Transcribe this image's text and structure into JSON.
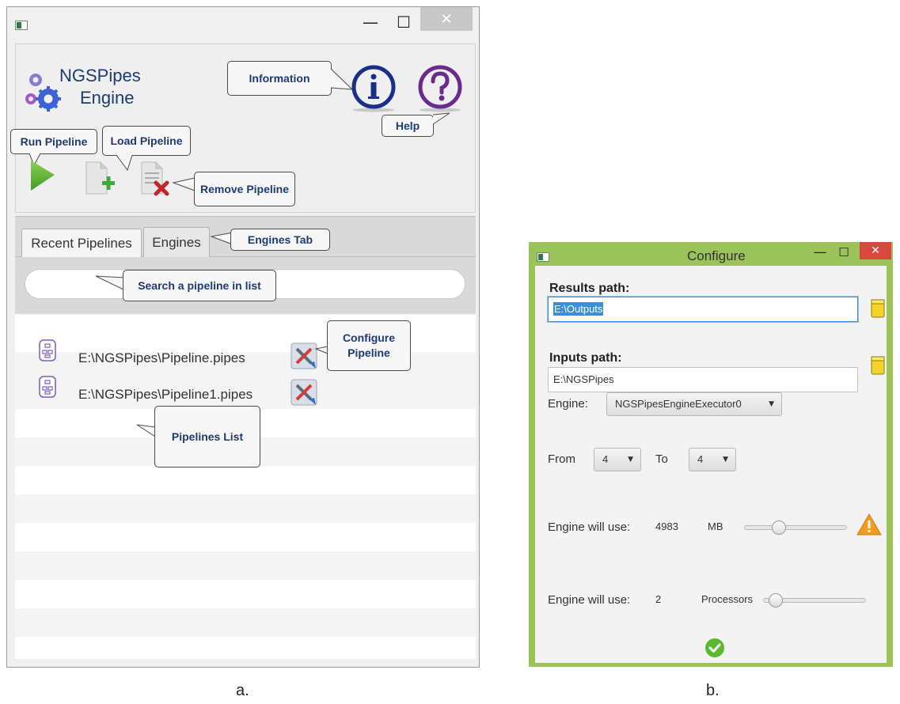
{
  "window_a": {
    "titlebar": {
      "minimize": "—",
      "maximize": "☐",
      "close": "✕"
    },
    "logo": {
      "line1": "NGSPipes",
      "line2": "Engine"
    },
    "callouts": {
      "information": "Information",
      "help": "Help",
      "run_pipeline": "Run Pipeline",
      "load_pipeline": "Load Pipeline",
      "remove_pipeline": "Remove Pipeline",
      "engines_tab": "Engines Tab",
      "search": "Search a pipeline in list",
      "configure_line1": "Configure",
      "configure_line2": "Pipeline",
      "pipelines_list": "Pipelines List"
    },
    "tabs": [
      {
        "label": "Recent Pipelines",
        "active": true
      },
      {
        "label": "Engines",
        "active": false
      }
    ],
    "search": {
      "placeholder": ""
    },
    "pipelines": [
      {
        "path": "E:\\NGSPipes\\Pipeline.pipes"
      },
      {
        "path": "E:\\NGSPipes\\Pipeline1.pipes"
      }
    ],
    "icons": {
      "information": "info-circle-icon",
      "help": "question-circle-icon",
      "run": "play-icon",
      "load": "add-file-icon",
      "remove": "remove-file-icon",
      "configure": "configure-tools-icon",
      "pipeline_file": "pipeline-file-icon"
    }
  },
  "window_b": {
    "title": "Configure",
    "titlebar": {
      "minimize": "—",
      "maximize": "☐",
      "close": "✕"
    },
    "results_label": "Results path:",
    "results_value": "E:\\Outputs",
    "inputs_label": "Inputs path:",
    "inputs_value": "E:\\NGSPipes",
    "engine_label": "Engine:",
    "engine_value": "NGSPipesEngineExecutor0",
    "from_label": "From",
    "from_value": "4",
    "to_label": "To",
    "to_value": "4",
    "memory_label": "Engine will use:",
    "memory_value": "4983",
    "memory_unit": "MB",
    "memory_level": 0.3,
    "cpu_label": "Engine will use:",
    "cpu_value": "2",
    "cpu_unit": "Processors",
    "cpu_level": 0.05,
    "icons": {
      "folder": "folder-icon",
      "warning": "warning-icon",
      "confirm": "check-circle-icon"
    }
  },
  "captions": {
    "a": "a.",
    "b": "b."
  },
  "colors": {
    "accent_green": "#9cc35a",
    "callout_text": "#1f3b73",
    "info_blue": "#1a2f8a",
    "help_purple": "#6a2b8f",
    "close_red": "#d9473f",
    "selection_blue": "#3a8fd8"
  }
}
